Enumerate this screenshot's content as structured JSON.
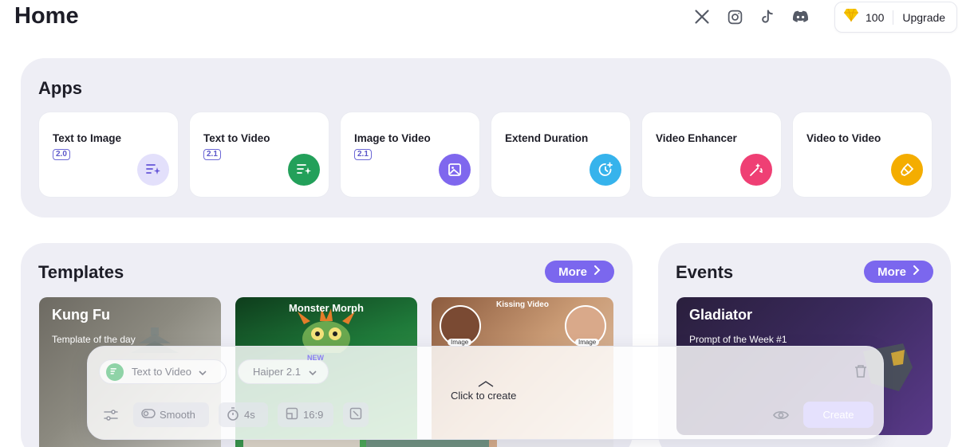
{
  "header": {
    "title": "Home",
    "socials": [
      "x-icon",
      "instagram-icon",
      "tiktok-icon",
      "discord-icon"
    ],
    "credits": {
      "amount": "100",
      "upgrade_label": "Upgrade"
    }
  },
  "apps": {
    "title": "Apps",
    "items": [
      {
        "name": "Text to Image",
        "version": "2.0",
        "icon": "text-sparkle-icon",
        "color": "#e3e0fb"
      },
      {
        "name": "Text to Video",
        "version": "2.1",
        "icon": "text-sparkle-icon",
        "color": "#23a05a"
      },
      {
        "name": "Image to Video",
        "version": "2.1",
        "icon": "image-icon",
        "color": "#7f67ee"
      },
      {
        "name": "Extend Duration",
        "version": "",
        "icon": "clock-plus-icon",
        "color": "#36b3ec"
      },
      {
        "name": "Video Enhancer",
        "version": "",
        "icon": "magic-wand-icon",
        "color": "#ef3f74"
      },
      {
        "name": "Video to Video",
        "version": "",
        "icon": "brush-icon",
        "color": "#f4ad00"
      }
    ]
  },
  "templates": {
    "title": "Templates",
    "more_label": "More",
    "items": [
      {
        "title": "Kung Fu",
        "subtitle": "Template of the day"
      },
      {
        "title": "Monster Morph"
      },
      {
        "title": "Kissing Video",
        "tag": "Image"
      }
    ]
  },
  "events": {
    "title": "Events",
    "more_label": "More",
    "items": [
      {
        "title": "Gladiator",
        "subtitle": "Prompt of the Week #1"
      }
    ]
  },
  "composer": {
    "mode": "Text to Video",
    "model": "Haiper 2.1",
    "new_badge": "NEW",
    "prompt_hint": "Click to create",
    "motion": "Smooth",
    "duration": "4s",
    "aspect_ratio": "16:9",
    "create_label": "Create"
  },
  "colors": {
    "accent": "#7b67ee",
    "panel_bg": "#eeeef5"
  }
}
